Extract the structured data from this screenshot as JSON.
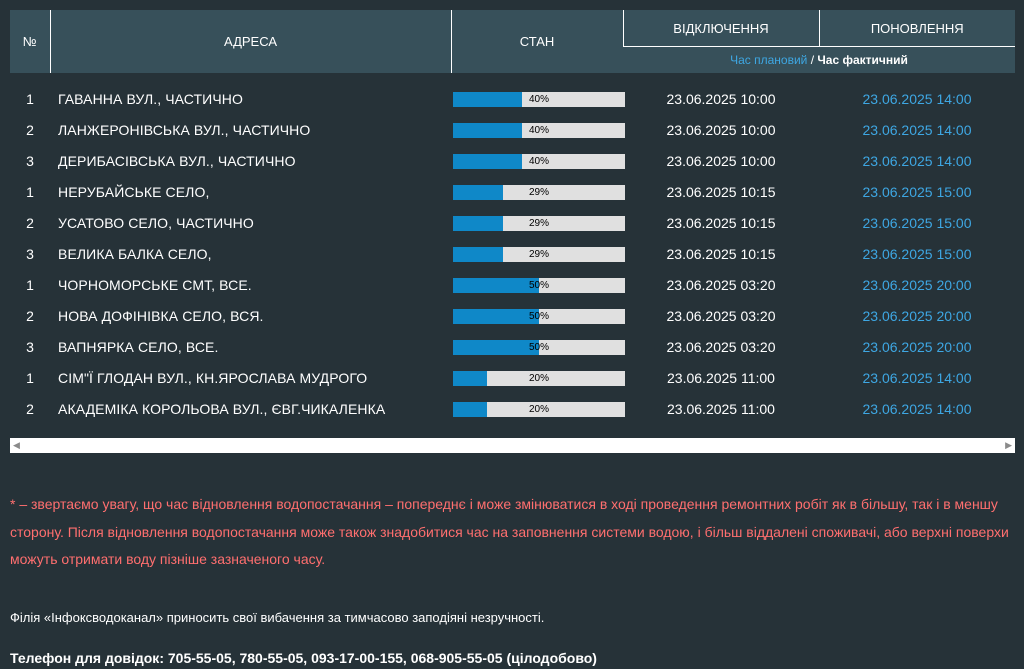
{
  "table": {
    "headers": {
      "num": "№",
      "address": "АДРЕСА",
      "state": "СТАН",
      "outage": "ВІДКЛЮЧЕННЯ",
      "restore": "ПОНОВЛЕННЯ"
    },
    "legend": {
      "planned": "Час плановий",
      "separator": " / ",
      "actual": "Час фактичний"
    },
    "rows": [
      {
        "num": "1",
        "address": "ГАВАННА ВУЛ., ЧАСТИЧНО",
        "progress": 0.4,
        "progress_label": "40%",
        "outage": "23.06.2025 10:00",
        "restore": "23.06.2025 14:00"
      },
      {
        "num": "2",
        "address": "ЛАНЖЕРОНІВСЬКА ВУЛ., ЧАСТИЧНО",
        "progress": 0.4,
        "progress_label": "40%",
        "outage": "23.06.2025 10:00",
        "restore": "23.06.2025 14:00"
      },
      {
        "num": "3",
        "address": "ДЕРИБАСІВСЬКА ВУЛ., ЧАСТИЧНО",
        "progress": 0.4,
        "progress_label": "40%",
        "outage": "23.06.2025 10:00",
        "restore": "23.06.2025 14:00"
      },
      {
        "num": "1",
        "address": "НЕРУБАЙСЬКЕ СЕЛО,",
        "progress": 0.29,
        "progress_label": "29%",
        "outage": "23.06.2025 10:15",
        "restore": "23.06.2025 15:00"
      },
      {
        "num": "2",
        "address": "УСАТОВО СЕЛО, ЧАСТИЧНО",
        "progress": 0.29,
        "progress_label": "29%",
        "outage": "23.06.2025 10:15",
        "restore": "23.06.2025 15:00"
      },
      {
        "num": "3",
        "address": "ВЕЛИКА БАЛКА СЕЛО,",
        "progress": 0.29,
        "progress_label": "29%",
        "outage": "23.06.2025 10:15",
        "restore": "23.06.2025 15:00"
      },
      {
        "num": "1",
        "address": "ЧОРНОМОРСЬКЕ СМТ, ВСЕ.",
        "progress": 0.5,
        "progress_label": "50%",
        "outage": "23.06.2025 03:20",
        "restore": "23.06.2025 20:00"
      },
      {
        "num": "2",
        "address": "НОВА ДОФІНІВКА СЕЛО, ВСЯ.",
        "progress": 0.5,
        "progress_label": "50%",
        "outage": "23.06.2025 03:20",
        "restore": "23.06.2025 20:00"
      },
      {
        "num": "3",
        "address": "ВАПНЯРКА СЕЛО, ВСЕ.",
        "progress": 0.5,
        "progress_label": "50%",
        "outage": "23.06.2025 03:20",
        "restore": "23.06.2025 20:00"
      },
      {
        "num": "1",
        "address": "СІМ\"Ї ГЛОДАН ВУЛ., КН.ЯРОСЛАВА МУДРОГО",
        "progress": 0.2,
        "progress_label": "20%",
        "outage": "23.06.2025 11:00",
        "restore": "23.06.2025 14:00"
      },
      {
        "num": "2",
        "address": "АКАДЕМІКА КОРОЛЬОВА ВУЛ., ЄВГ.ЧИКАЛЕНКА",
        "progress": 0.2,
        "progress_label": "20%",
        "outage": "23.06.2025 11:00",
        "restore": "23.06.2025 14:00"
      }
    ]
  },
  "notice": "* – звертаємо увагу, що час відновлення водопостачання – попереднє і може змінюватися в ході проведення ремонтних робіт як в більшу, так і в меншу сторону. Після відновлення водопостачання може також знадобитися час на заповнення системи водою, і більш віддалені споживачі, або верхні поверхи можуть отримати воду пізніше зазначеного часу.",
  "apology": "Філія «Інфоксводоканал» приносить свої вибачення за тимчасово заподіяні незручності.",
  "phones": "Телефон для довідок: 705-55-05, 780-55-05, 093-17-00-155, 068-905-55-05 (цілодобово)",
  "colors": {
    "background": "#263238",
    "header": "#37505a",
    "accent": "#3ea7e3",
    "bar_fill": "#0f88c8",
    "bar_track": "#e0e0e0",
    "notice": "#ff6f6f"
  },
  "icons": {
    "scroll_left": "arrow-left-icon",
    "scroll_right": "arrow-right-icon"
  }
}
